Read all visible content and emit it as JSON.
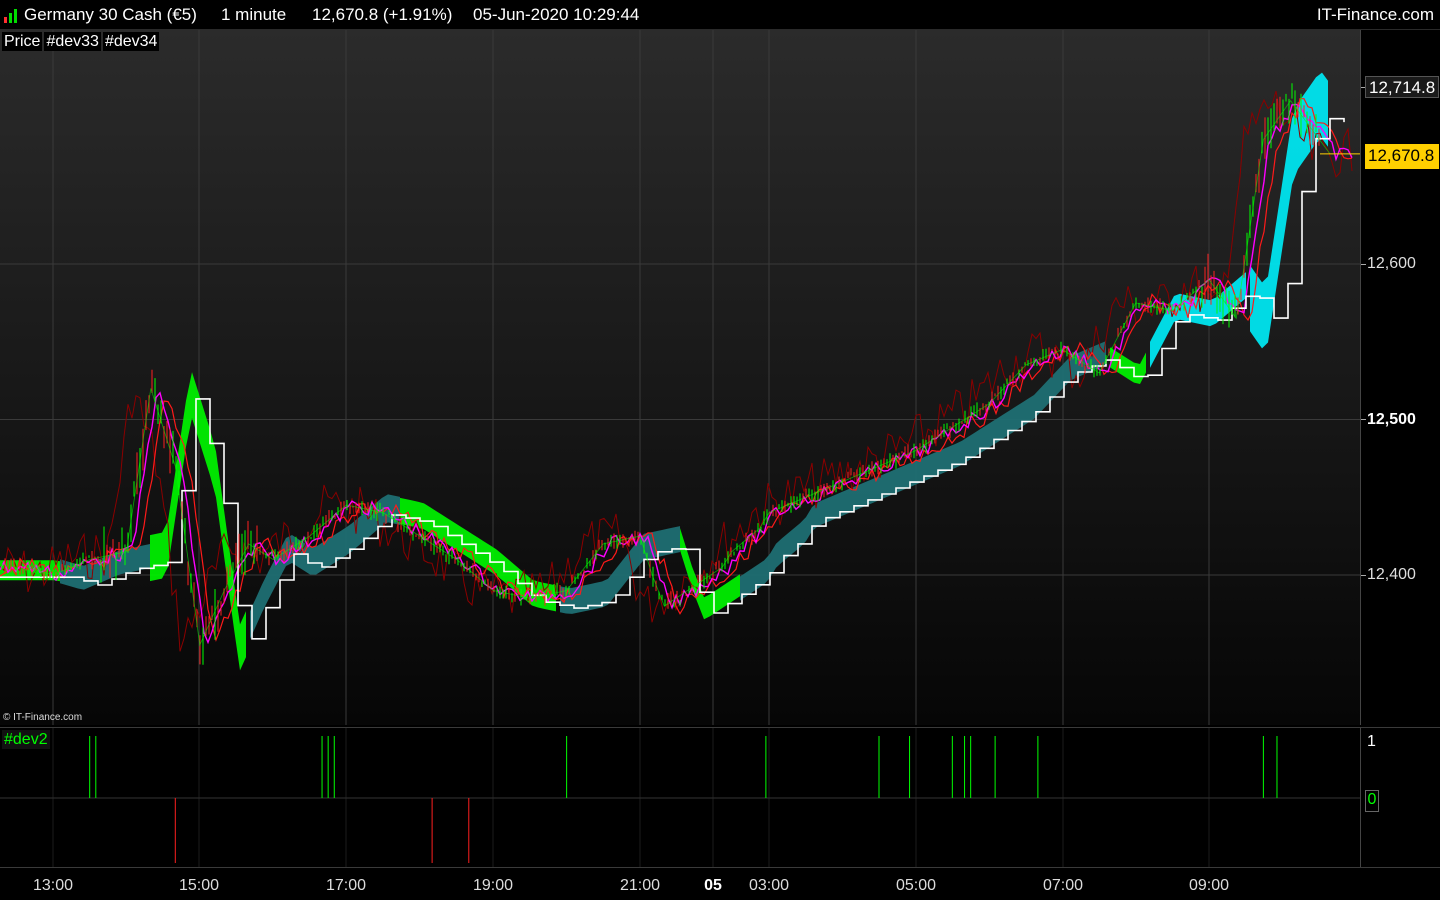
{
  "header": {
    "instrument": "Germany 30 Cash (€5)",
    "timeframe": "1 minute",
    "price_change": "12,670.8 (+1.91%)",
    "datetime": "05-Jun-2020 10:29:44",
    "brand": "IT-Finance.com"
  },
  "legend": {
    "price": "Price",
    "dev33": "#dev33",
    "dev34": "#dev34",
    "dev2": "#dev2"
  },
  "watermark": "© IT-Finance.com",
  "price_axis": {
    "hi_label": "12,714.8",
    "last_label": "12,670.8",
    "labels": [
      "12,600",
      "12,500",
      "12,400"
    ]
  },
  "sub_axis": {
    "top_label": "1",
    "zero_label": "0"
  },
  "time_axis": [
    "13:00",
    "15:00",
    "17:00",
    "19:00",
    "21:00",
    "05",
    "03:00",
    "05:00",
    "07:00",
    "09:00"
  ],
  "colors": {
    "candle_up": "#00ff00",
    "candle_down": "#ff2020",
    "cloud_green": "#00ee00",
    "cloud_teal": "#1f6f73",
    "cloud_cyan": "#00e5ef",
    "line_white": "#ffffff",
    "line_magenta": "#ff00ff",
    "line_red": "#ff1a1a",
    "line_darkred": "#8b0000",
    "last_price": "#ffd000"
  },
  "chart_data": [
    {
      "type": "line",
      "title": "Germany 30 Cash (€5)",
      "ylim": [
        12310,
        12740
      ],
      "yticks": [
        12400,
        12500,
        12600,
        12714.8
      ],
      "x": [
        "12:35",
        "13:00",
        "13:30",
        "14:00",
        "14:20",
        "14:40",
        "15:00",
        "15:20",
        "15:40",
        "16:00",
        "16:30",
        "17:00",
        "17:30",
        "18:00",
        "18:30",
        "19:00",
        "19:30",
        "20:00",
        "20:30",
        "21:00",
        "21:30",
        "22:00",
        "00:30",
        "01:00",
        "01:30",
        "02:00",
        "02:30",
        "03:00",
        "03:30",
        "04:00",
        "04:30",
        "05:00",
        "05:30",
        "06:00",
        "06:30",
        "07:00",
        "07:30",
        "08:00",
        "08:30",
        "09:00",
        "09:20",
        "09:40",
        "10:00",
        "10:29"
      ],
      "series": [
        {
          "name": "Price",
          "values": [
            12405,
            12400,
            12410,
            12415,
            12520,
            12470,
            12355,
            12390,
            12420,
            12410,
            12425,
            12445,
            12440,
            12425,
            12410,
            12390,
            12385,
            12390,
            12420,
            12425,
            12400,
            12380,
            12405,
            12415,
            12420,
            12425,
            12430,
            12440,
            12450,
            12460,
            12470,
            12480,
            12495,
            12510,
            12535,
            12545,
            12530,
            12575,
            12570,
            12590,
            12565,
            12680,
            12705,
            12670.8
          ]
        }
      ]
    },
    {
      "type": "bar",
      "title": "#dev2",
      "ylim": [
        -1,
        1
      ],
      "x": [
        "13:30",
        "13:35",
        "14:40",
        "16:40",
        "16:45",
        "16:50",
        "18:10",
        "18:40",
        "20:00",
        "02:50",
        "04:30",
        "04:55",
        "05:30",
        "05:40",
        "05:45",
        "06:05",
        "06:40",
        "09:40",
        "09:50"
      ],
      "values": [
        1,
        1,
        -1,
        1,
        1,
        1,
        -1,
        -1,
        1,
        1,
        1,
        1,
        1,
        1,
        1,
        1,
        1,
        1,
        1
      ]
    }
  ]
}
